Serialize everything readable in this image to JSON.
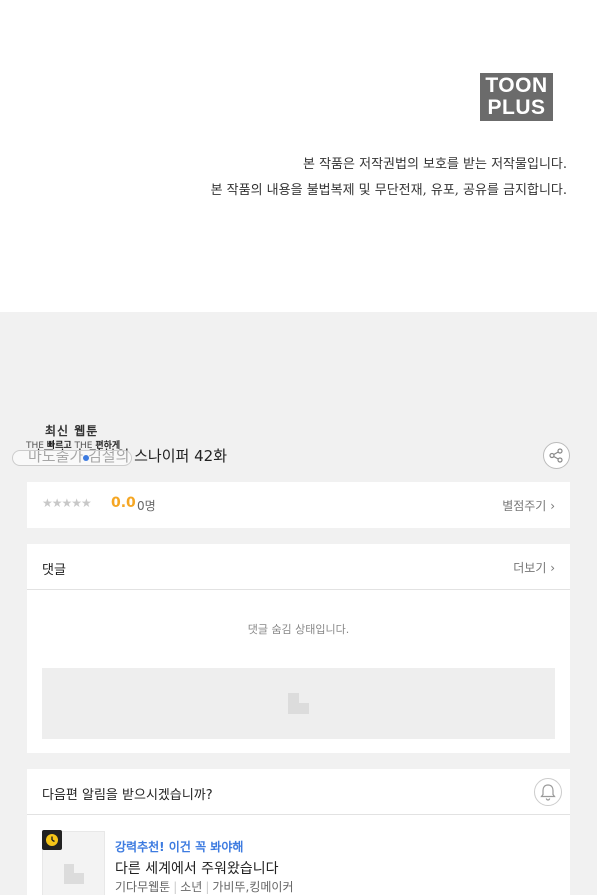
{
  "logo": {
    "line1": "TOON",
    "line2": "PLUS"
  },
  "copyright": {
    "line1": "본 작품은 저작권법의 보호를 받는 저작물입니다.",
    "line2": "본 작품의 내용을 불법복제 및 무단전재, 유포, 공유를 금지합니다."
  },
  "banner": {
    "title": "최신 웹툰",
    "sub_prefix1": "THE ",
    "sub_word1": "빠르고",
    "sub_prefix2": " THE ",
    "sub_word2": "편하게"
  },
  "episode": {
    "title": "마도출가 김철의 스나이퍼 42화"
  },
  "rating": {
    "stars": "★★★★★",
    "score": "0.0",
    "count": "0명",
    "rate_link": "별점주기",
    "chevron": "›"
  },
  "comments": {
    "title": "댓글",
    "more": "더보기",
    "chevron": "›",
    "hidden_message": "댓글 숨김 상태입니다."
  },
  "next": {
    "title": "다음편 알림을 받으시겠습니까?",
    "rec_tag": "강력추천! 이건 꼭 봐야해",
    "rec_title": "다른 세계에서 주워왔습니다",
    "rec_genre": "기다무웹툰",
    "rec_category": "소년",
    "rec_authors": "가비뚜,킹메이커"
  },
  "colors": {
    "accent_blue": "#3d7be0",
    "score_orange": "#f5a623",
    "logo_gray": "#6b6b6b",
    "clock_yellow": "#f5c518"
  },
  "icons": [
    "share-icon",
    "bell-icon",
    "clock-icon",
    "image-placeholder-icon",
    "star-icon",
    "chevron-right-icon"
  ]
}
